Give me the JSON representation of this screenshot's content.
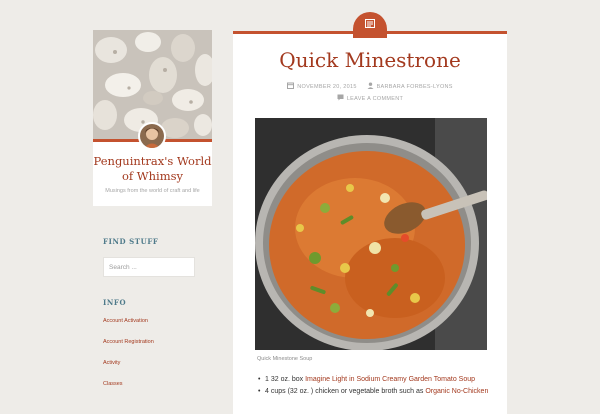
{
  "site": {
    "title": "Penguintrax's World of Whimsy",
    "tagline": "Musings from the world of craft and life",
    "colors": {
      "accent": "#c4522f",
      "title": "#a3391e",
      "widget": "#4e7a8a",
      "background": "#eeece8"
    }
  },
  "sidebar": {
    "find_stuff_title": "FIND STUFF",
    "search_placeholder": "Search ...",
    "info_title": "INFO",
    "info_links": [
      "Account Activation",
      "Account Registration",
      "Activity",
      "Classes"
    ]
  },
  "post": {
    "format_icon": "standard-post-icon",
    "title": "Quick Minestrone",
    "date": "NOVEMBER 20, 2015",
    "author": "BARBARA FORBES-LYONS",
    "comment_link": "LEAVE A COMMENT",
    "image_caption": "Quick Minestone Soup",
    "ingredients": [
      {
        "prefix": "1 32 oz. box ",
        "link": "Imagine Light in Sodium Creamy Garden Tomato Soup",
        "suffix": ""
      },
      {
        "prefix": "4 cups (32 oz. ) chicken or vegetable broth such as ",
        "link": "Organic No-Chicken",
        "suffix": ""
      }
    ]
  }
}
